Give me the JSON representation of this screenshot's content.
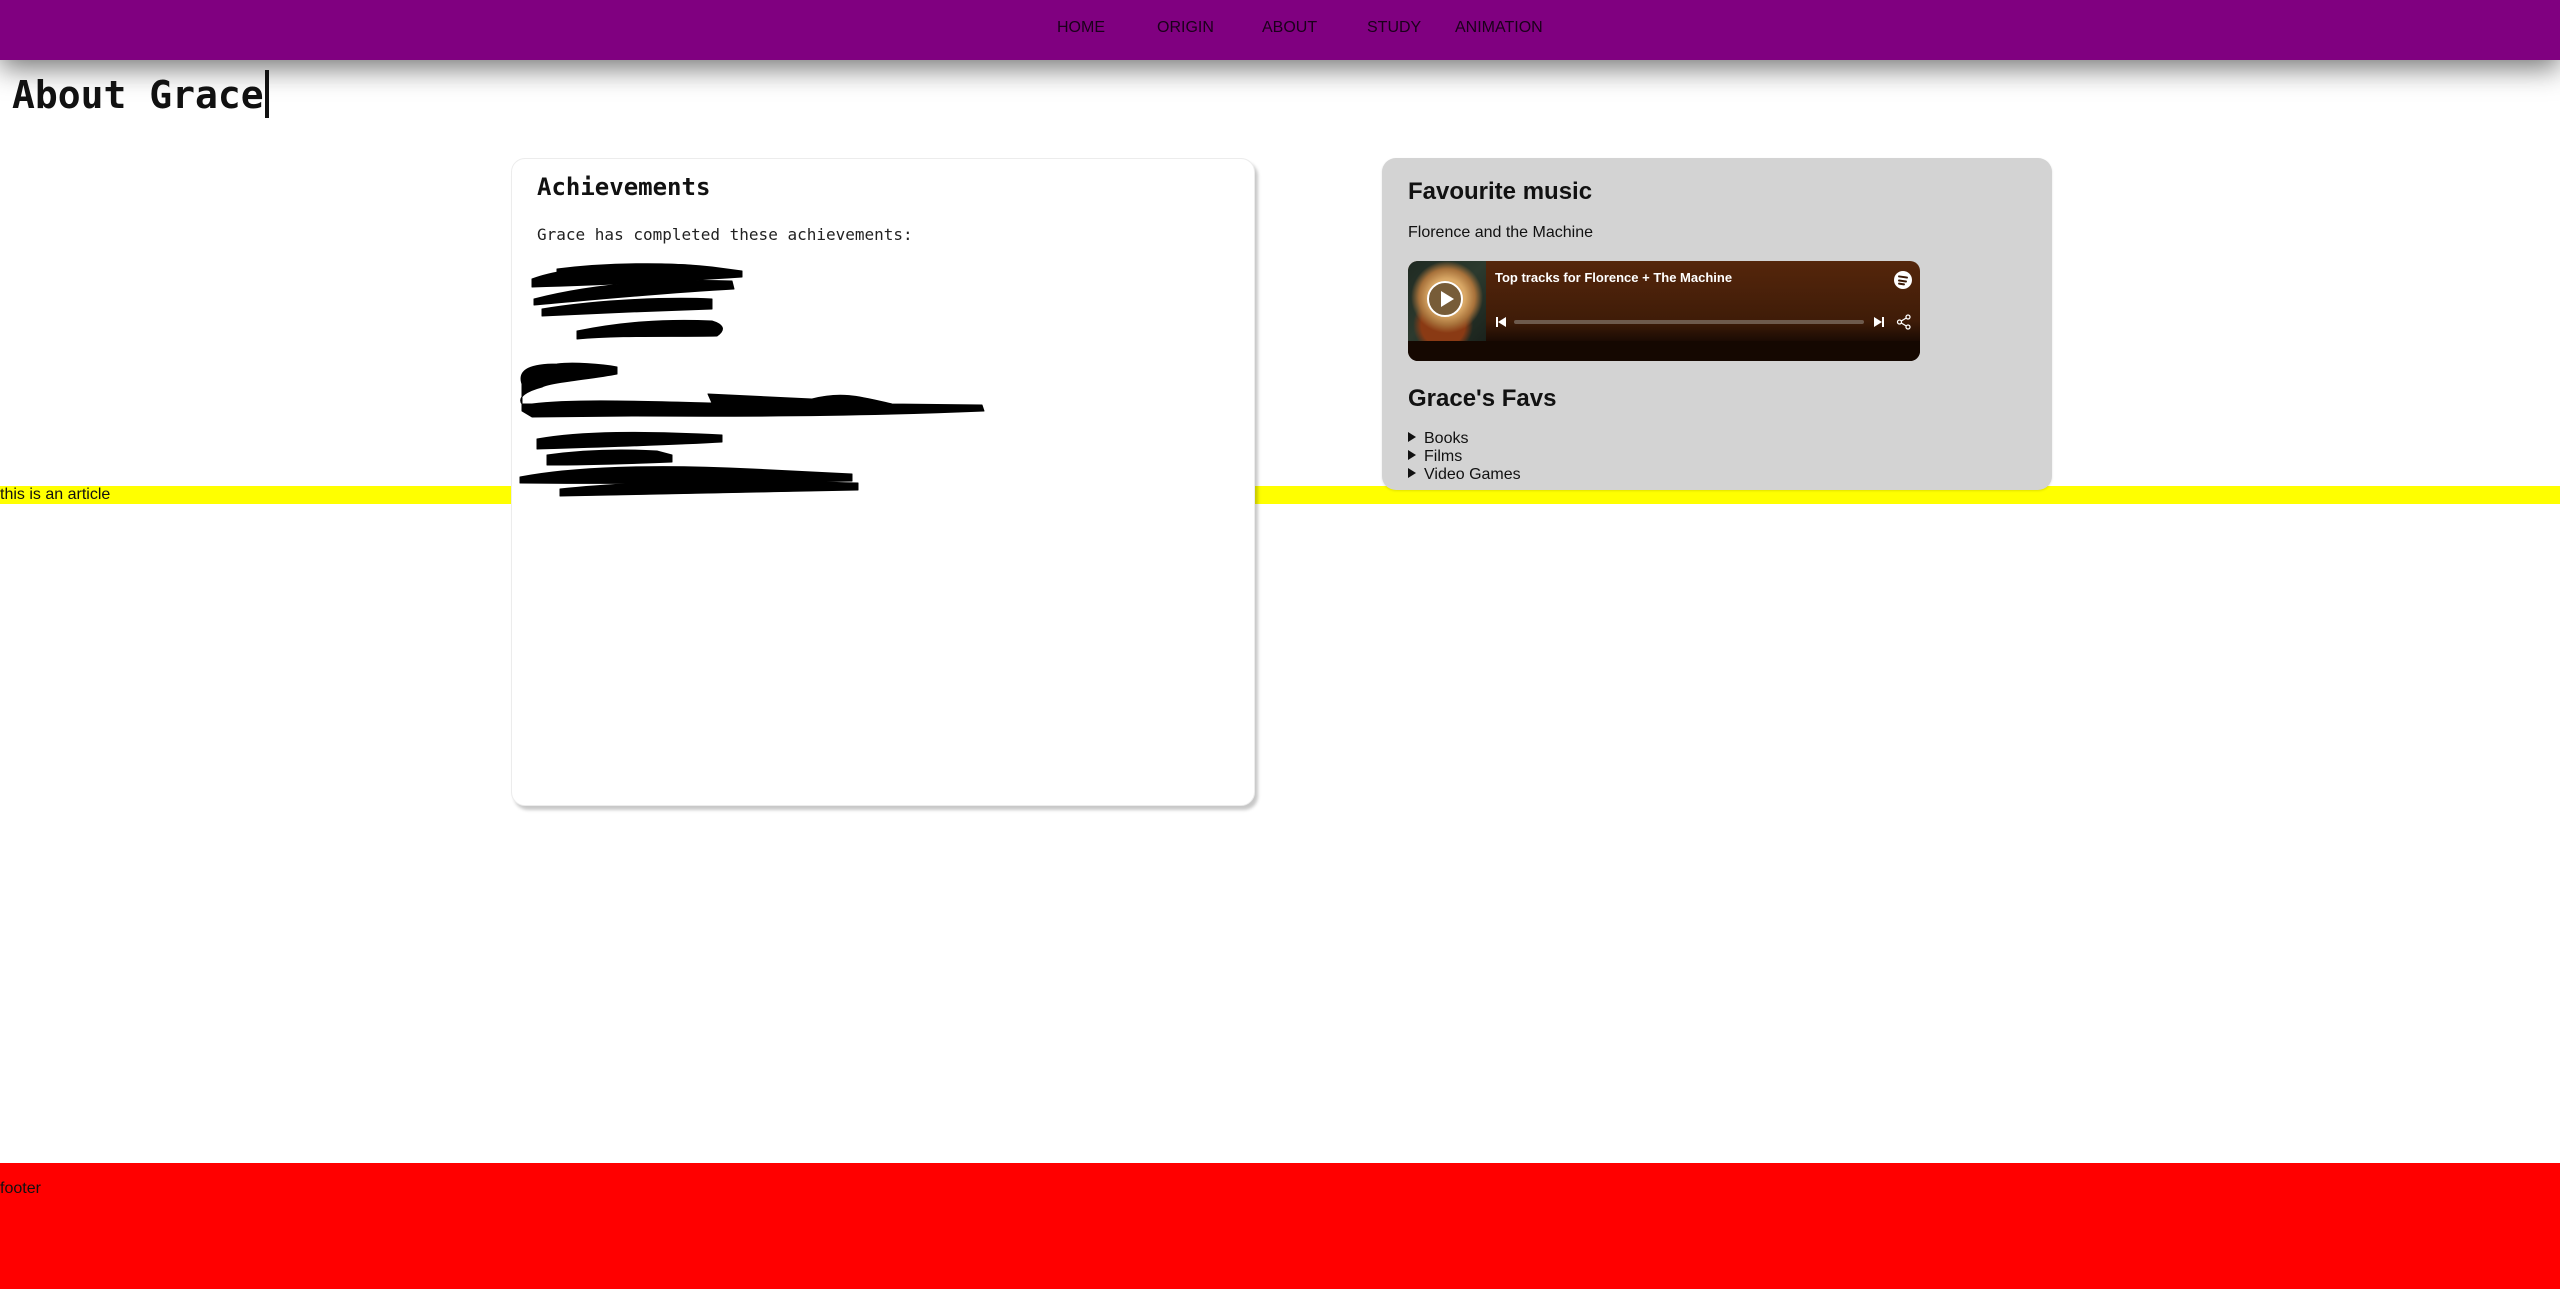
{
  "nav": {
    "background": "#800080",
    "items": [
      {
        "label": "HOME"
      },
      {
        "label": "ORIGIN"
      },
      {
        "label": "ABOUT"
      },
      {
        "label": "STUDY"
      },
      {
        "label": "ANIMATION"
      }
    ]
  },
  "page": {
    "title": "About Grace"
  },
  "article": {
    "text": "this is an article",
    "background": "#ffff00"
  },
  "achievements": {
    "heading": "Achievements",
    "intro": "Grace has completed these achievements:",
    "content_state": "redacted"
  },
  "favourites": {
    "background": "#d3d3d3",
    "music_heading": "Favourite music",
    "artist": "Florence and the Machine",
    "player": {
      "title": "Top tracks for Florence + The Machine",
      "icons": {
        "play": "play-icon",
        "logo": "spotify-logo-icon",
        "previous": "skip-previous-icon",
        "next": "skip-next-icon",
        "share": "share-icon"
      },
      "progress_fraction": 0
    },
    "favs_heading": "Grace's Favs",
    "favs_items": [
      {
        "label": "Books"
      },
      {
        "label": "Films"
      },
      {
        "label": "Video Games"
      }
    ]
  },
  "footer": {
    "text": "footer",
    "background": "#ff0000"
  }
}
